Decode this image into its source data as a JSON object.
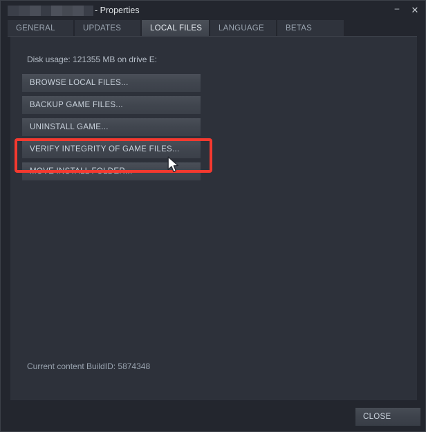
{
  "window": {
    "title_redacted": true,
    "title_suffix": "- Properties",
    "minimize_label": "–",
    "close_label": "✕"
  },
  "tabs": [
    {
      "label": "GENERAL",
      "active": false
    },
    {
      "label": "UPDATES",
      "active": false
    },
    {
      "label": "LOCAL FILES",
      "active": true
    },
    {
      "label": "LANGUAGE",
      "active": false
    },
    {
      "label": "BETAS",
      "active": false
    }
  ],
  "content": {
    "disk_usage": "Disk usage: 121355 MB on drive E:",
    "buttons": [
      "BROWSE LOCAL FILES...",
      "BACKUP GAME FILES...",
      "UNINSTALL GAME...",
      "VERIFY INTEGRITY OF GAME FILES...",
      "MOVE INSTALL FOLDER..."
    ],
    "build_id": "Current content BuildID: 5874348"
  },
  "footer": {
    "close_label": "CLOSE"
  },
  "annotation": {
    "highlight_color": "#f4392f",
    "highlight_target": "VERIFY INTEGRITY OF GAME FILES..."
  }
}
